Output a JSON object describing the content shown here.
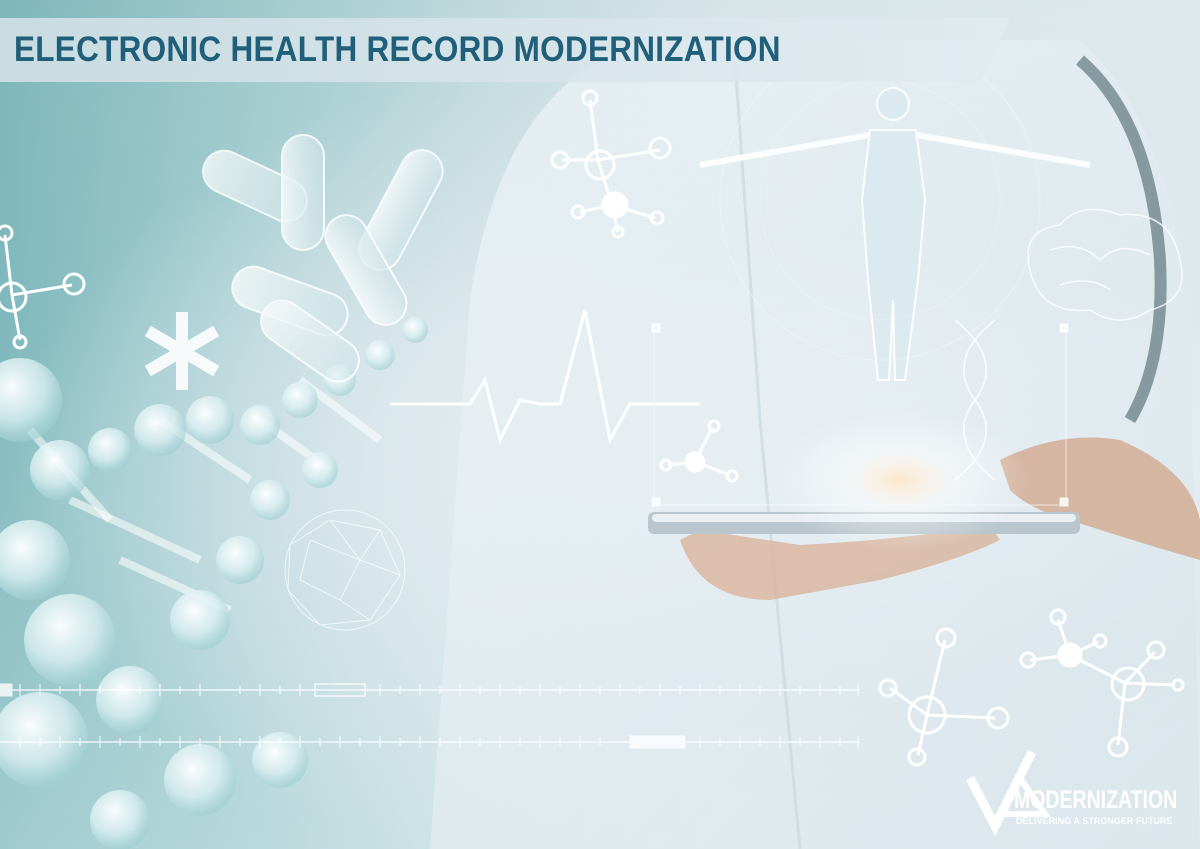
{
  "banner": {
    "title": "ELECTRONIC HEALTH RECORD MODERNIZATION"
  },
  "logo": {
    "name": "MODERNIZATION",
    "tagline": "DELIVERING A STRONGER FUTURE"
  },
  "colors": {
    "title_text": "#1f5f7a",
    "banner_bg": "#d6e4e9",
    "background_teal": "#7fb9bd",
    "logo_text": "#ffffff"
  },
  "icons": [
    "dna-helix",
    "pill-capsule",
    "asterisk-medical-symbol",
    "molecule",
    "heartbeat-line",
    "human-body-hologram",
    "brain",
    "tablet",
    "network-globe",
    "check-triangle-logo-mark"
  ]
}
